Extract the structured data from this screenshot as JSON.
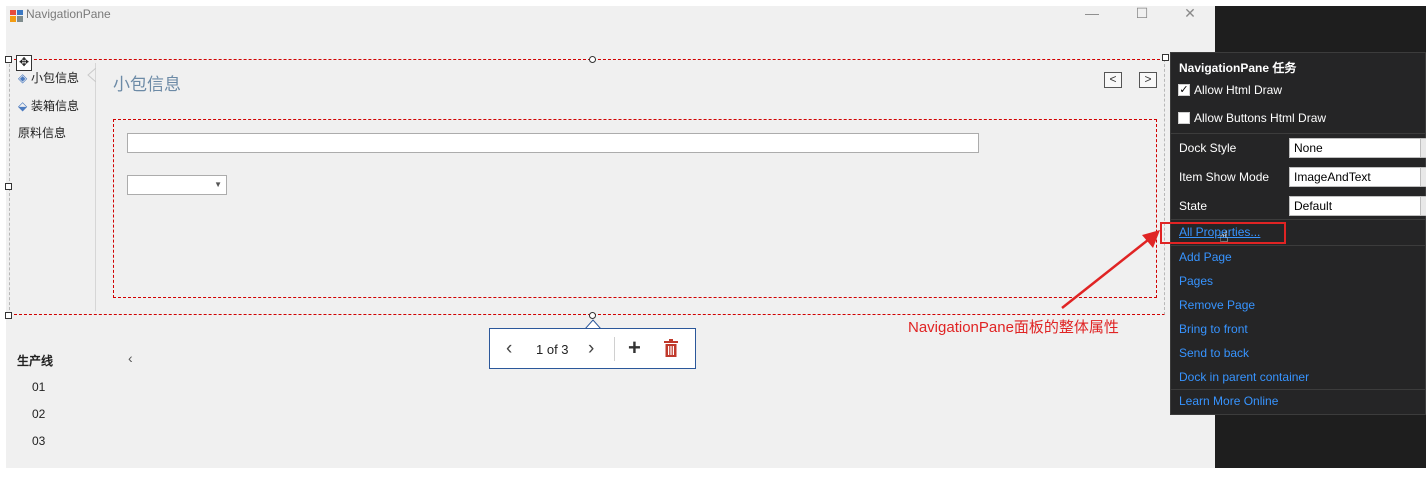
{
  "window": {
    "title": "NavigationPane",
    "minimize": "—",
    "maximize": "☐",
    "close": "✕"
  },
  "navigation_pane": {
    "items": [
      {
        "label": "小包信息",
        "icon": "layers-icon"
      },
      {
        "label": "装箱信息",
        "icon": "box-stack-icon"
      },
      {
        "label": "原料信息"
      }
    ],
    "page_title": "小包信息",
    "prev_button": "<",
    "next_button": ">"
  },
  "pager": {
    "prev": "‹",
    "count": "1 of 3",
    "next": "›",
    "add": "+"
  },
  "group": {
    "header": "生产线",
    "collapse": "‹",
    "items": [
      "01",
      "02",
      "03"
    ]
  },
  "tasks_panel": {
    "title": "NavigationPane 任务",
    "allow_html_draw": {
      "label": "Allow Html Draw",
      "checked": true,
      "mark": "✓"
    },
    "allow_buttons_html_draw": {
      "label": "Allow Buttons Html Draw",
      "checked": false
    },
    "dock_style": {
      "label": "Dock Style",
      "value": "None"
    },
    "item_show_mode": {
      "label": "Item Show Mode",
      "value": "ImageAndText"
    },
    "state": {
      "label": "State",
      "value": "Default"
    },
    "links": {
      "all_properties": "All Properties...",
      "add_page": "Add Page",
      "pages": "Pages",
      "remove_page": "Remove Page",
      "bring_to_front": "Bring to front",
      "send_to_back": "Send to back",
      "dock_in_parent": "Dock in parent container",
      "learn_more": "Learn More Online"
    }
  },
  "annotation": {
    "text": "NavigationPane面板的整体属性",
    "color": "#e02424"
  },
  "colors": {
    "link": "#3794ff",
    "panel_bg": "#252526",
    "accent": "#2b579a",
    "title_blue": "#6c8aa6"
  }
}
